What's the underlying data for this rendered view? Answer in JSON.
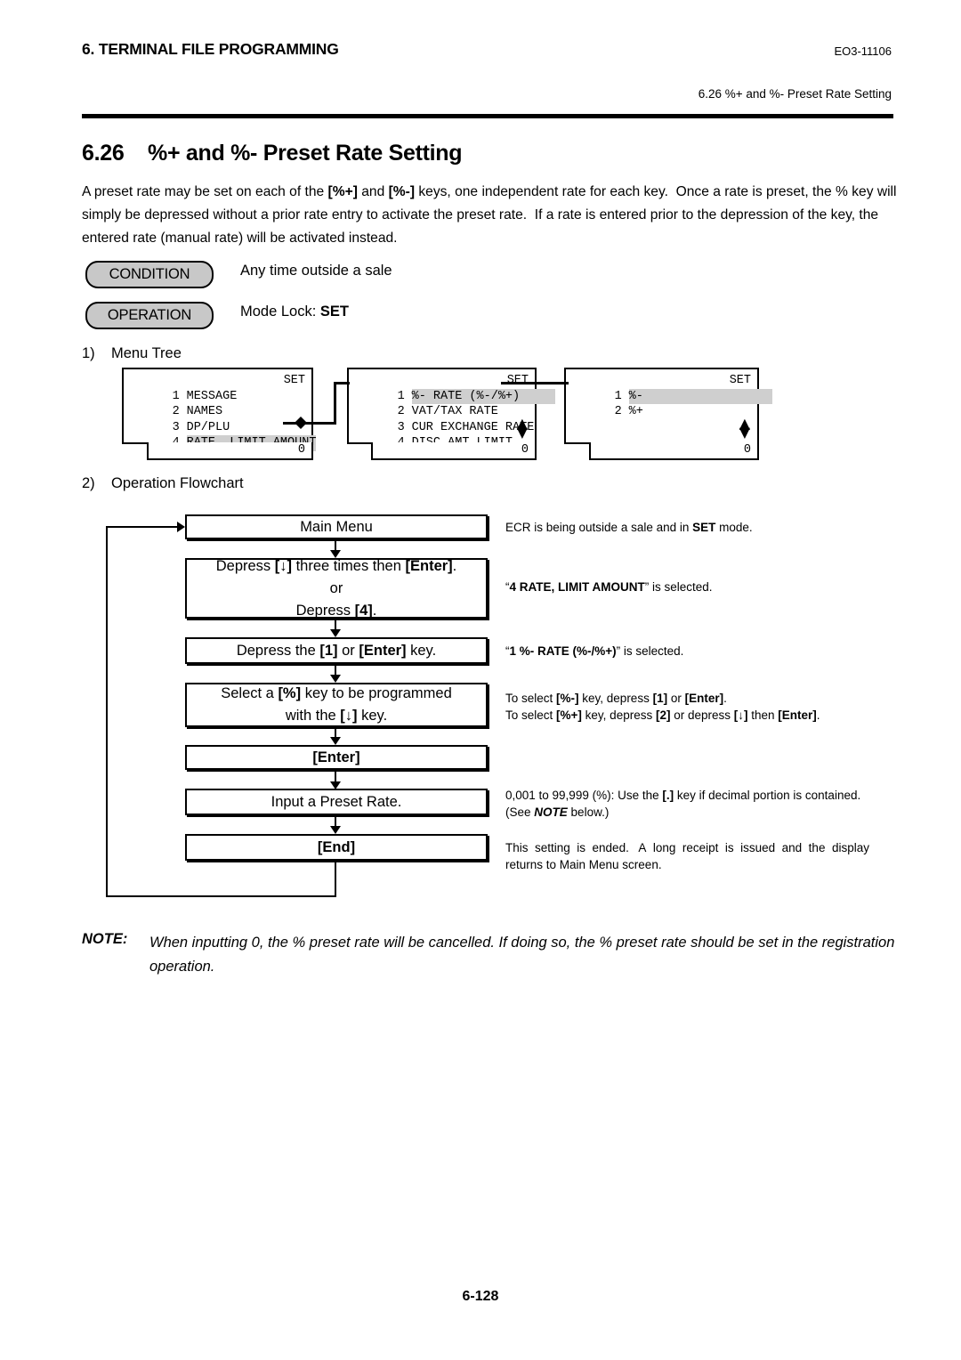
{
  "header": {
    "chapter": "6. TERMINAL FILE PROGRAMMING",
    "doc_no": "EO3-11106",
    "section_running_head": "6.26 %+ and %- Preset Rate Setting"
  },
  "section": {
    "number": "6.26",
    "title": "%+ and %- Preset Rate Setting",
    "full_title": "6.26    %+ and %- Preset Rate Setting",
    "intro_html": "A preset rate may be set on each of the <b>[%+]</b> and <b>[%-]</b> keys, one independent rate for each key.&nbsp; Once a rate is preset, the % key will simply be depressed without a prior rate entry to activate the preset rate.&nbsp; If a rate is entered prior to the depression of the key, the entered rate (manual rate) will be activated instead."
  },
  "condition": {
    "pill_label": "CONDITION",
    "text": "Any time outside a sale"
  },
  "operation": {
    "pill_label": "OPERATION",
    "text_html": "Mode Lock: <b>SET</b>"
  },
  "steps": {
    "step1_label": "1)    Menu Tree",
    "step2_label": "2)    Operation Flowchart"
  },
  "menu_tree": {
    "boxes": [
      {
        "name": "main-menu-screen",
        "rows": [
          {
            "num": "1",
            "text": "MESSAGE",
            "highlight": false,
            "right": "SET"
          },
          {
            "num": "2",
            "text": "NAMES",
            "highlight": false,
            "right": ""
          },
          {
            "num": "3",
            "text": "DP/PLU",
            "highlight": false,
            "right": ""
          },
          {
            "num": "4",
            "text": "RATE, LIMIT AMOUNT",
            "highlight": true,
            "right": ""
          }
        ],
        "status": "0",
        "scroll_indicator": false
      },
      {
        "name": "rate-limit-amount-screen",
        "rows": [
          {
            "num": "1",
            "text": "%- RATE (%-/%+)",
            "highlight": true,
            "right": "SET"
          },
          {
            "num": "2",
            "text": "VAT/TAX RATE",
            "highlight": false,
            "right": ""
          },
          {
            "num": "3",
            "text": "CUR EXCHANGE RATE",
            "highlight": false,
            "right": ""
          },
          {
            "num": "4",
            "text": "DISC AMT LIMIT",
            "highlight": false,
            "right": ""
          }
        ],
        "status": "0",
        "scroll_indicator": true
      },
      {
        "name": "percent-key-select-screen",
        "rows": [
          {
            "num": "1",
            "text": "%-",
            "highlight": true,
            "right": "SET"
          },
          {
            "num": "2",
            "text": "%+",
            "highlight": false,
            "right": ""
          },
          {
            "num": "",
            "text": "",
            "highlight": false,
            "right": ""
          },
          {
            "num": "",
            "text": "",
            "highlight": false,
            "right": ""
          }
        ],
        "status": "0",
        "scroll_indicator": true
      }
    ]
  },
  "flowchart": {
    "boxes": [
      {
        "name": "main-menu",
        "lines_html": [
          "Main Menu"
        ]
      },
      {
        "name": "depress-down-three-times",
        "lines_html": [
          "Depress <b>[↓]</b> three times then <b>[Enter]</b>.",
          "or",
          "Depress <b>[4]</b>."
        ]
      },
      {
        "name": "depress-1-or-enter",
        "lines_html": [
          "Depress the <b>[1]</b> or <b>[Enter]</b> key."
        ]
      },
      {
        "name": "select-percent-key",
        "lines_html": [
          "Select a <b>[%]</b> key to be programmed",
          "with the <b>[↓]</b> key."
        ]
      },
      {
        "name": "enter",
        "lines_html": [
          "<b>[Enter]</b>"
        ]
      },
      {
        "name": "input-preset-rate",
        "lines_html": [
          "Input a Preset Rate."
        ]
      },
      {
        "name": "end",
        "lines_html": [
          "<b>[End]</b>"
        ]
      }
    ],
    "notes": [
      {
        "name": "note-main-menu",
        "html": "ECR is being outside a sale and in <b>SET</b> mode."
      },
      {
        "name": "note-rate-limit-selected",
        "html": "“<b>4 RATE, LIMIT AMOUNT</b>” is selected."
      },
      {
        "name": "note-percent-rate-selected",
        "html": "“<b>1 %- RATE (%-/%+)</b>” is selected."
      },
      {
        "name": "note-select-percent-key",
        "html": "To select <b>[%-]</b> key, depress <b>[1]</b> or <b>[Enter]</b>.<br>To select <b>[%+]</b> key, depress <b>[2]</b> or depress <b>[↓]</b> then <b>[Enter]</b>."
      },
      {
        "name": "note-input-range",
        "html": "0,001 to 99,999 (%): Use the <b>[.]</b> key if decimal portion is contained.<br>(See <b><i>NOTE</i></b> below.)"
      },
      {
        "name": "note-end",
        "html": "This&nbsp; setting&nbsp; is&nbsp; ended.&nbsp;&nbsp; A&nbsp; long&nbsp; receipt&nbsp; is&nbsp; issued&nbsp; and&nbsp; the&nbsp; display<br>returns to Main Menu screen."
      }
    ]
  },
  "note": {
    "label": "NOTE:",
    "body": "When inputting 0, the % preset rate will be cancelled.  If doing so, the % preset rate should be set in the registration operation."
  },
  "footer": {
    "page_number": "6-128"
  },
  "colors": {
    "highlight_gray": "#cfcfcf",
    "pill_gray": "#c8c8c8",
    "ink": "#000000",
    "paper": "#ffffff"
  }
}
